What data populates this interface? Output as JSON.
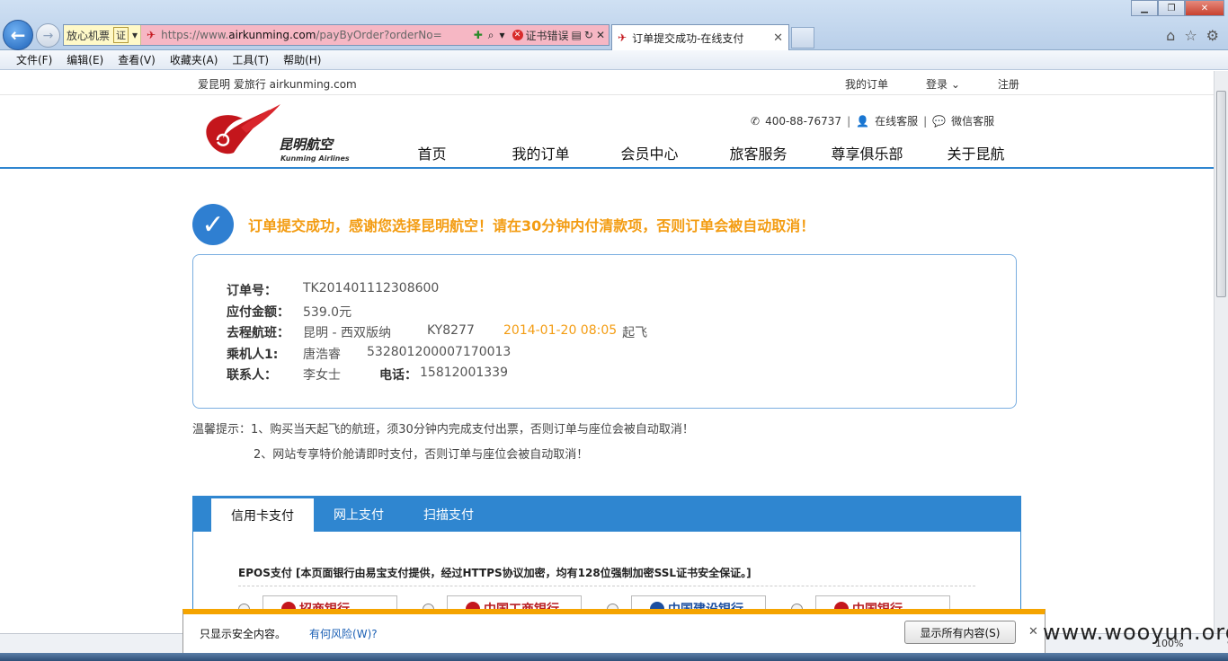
{
  "browser": {
    "addr_tag": "放心机票",
    "cert_tag": "证",
    "url_prefix": "https://www.",
    "url_domain": "airkunming.com",
    "url_suffix": "/payByOrder?orderNo=",
    "cert_error": "证书错误",
    "active_tab": "订单提交成功-在线支付",
    "zoom": "100%"
  },
  "menu": [
    "文件(F)",
    "编辑(E)",
    "查看(V)",
    "收藏夹(A)",
    "工具(T)",
    "帮助(H)"
  ],
  "topbar": {
    "site": "爱昆明 爱旅行 airkunming.com",
    "my_orders": "我的订单",
    "login": "登录 ⌄",
    "register": "注册"
  },
  "header": {
    "logo_cn": "昆明航空",
    "logo_en": "Kunming Airlines",
    "phone": "400-88-76737",
    "online_service": "在线客服",
    "wechat_service": "微信客服",
    "nav": [
      "首页",
      "我的订单",
      "会员中心",
      "旅客服务",
      "尊享俱乐部",
      "关于昆航"
    ]
  },
  "success_message": "订单提交成功，感谢您选择昆明航空！请在30分钟内付清款项，否则订单会被自动取消！",
  "order": {
    "order_no_label": "订单号：",
    "order_no": "TK201401112308600",
    "amount_label": "应付金额：",
    "amount": "539.0元",
    "flight_label": "去程航班：",
    "route": "昆明 - 西双版纳",
    "flight_no": "KY8277",
    "depart_time": "2014-01-20 08:05",
    "depart_suffix": "起飞",
    "passenger_label": "乘机人1:",
    "passenger_name": "唐浩睿",
    "passenger_id": "532801200007170013",
    "contact_label": "联系人：",
    "contact_name": "李女士",
    "phone_label": "电话：",
    "phone": "15812001339"
  },
  "tips": {
    "line1": "温馨提示：1、购买当天起飞的航班，须30分钟内完成支付出票，否则订单与座位会被自动取消！",
    "line2": "2、网站专享特价舱请即时支付，否则订单与座位会被自动取消！"
  },
  "payment": {
    "tabs": [
      "信用卡支付",
      "网上支付",
      "扫描支付"
    ],
    "epos_text": "EPOS支付 [本页面银行由易宝支付提供，经过HTTPS协议加密，均有128位强制加密SSL证书安全保证。]",
    "banks": [
      "招商银行",
      "中国工商银行",
      "中国建设银行",
      "中国银行"
    ]
  },
  "infobar": {
    "message": "只显示安全内容。",
    "risk_link": "有何风险(W)?",
    "show_all": "显示所有内容(S)"
  },
  "watermark": "www.wooyun.org"
}
